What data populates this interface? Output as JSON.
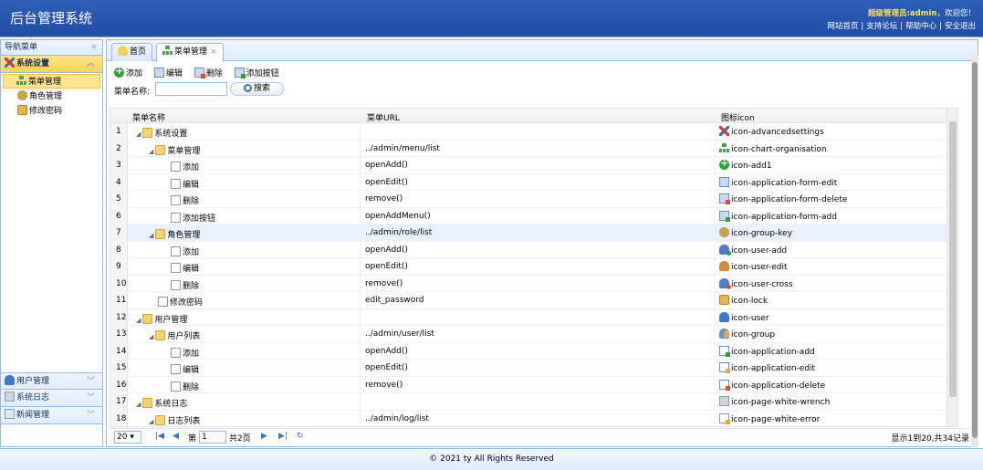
{
  "header": {
    "title": "后台管理系统",
    "welcome_user": "超级管理员:admin",
    "welcome_text": "，欢迎您！",
    "links": [
      "网站首页",
      "支持论坛",
      "帮助中心",
      "安全退出"
    ]
  },
  "sidebar": {
    "title": "导航菜单",
    "groups": [
      {
        "label": "系统设置",
        "icon": "advanced-settings-icon",
        "selected": true,
        "items": [
          {
            "label": "菜单管理",
            "icon": "org-chart-icon",
            "selected": true
          },
          {
            "label": "角色管理",
            "icon": "group-key-icon"
          },
          {
            "label": "修改密码",
            "icon": "lock-icon"
          }
        ]
      },
      {
        "label": "用户管理",
        "icon": "user-icon"
      },
      {
        "label": "系统日志",
        "icon": "wrench-icon"
      },
      {
        "label": "新闻管理",
        "icon": "news-icon"
      }
    ]
  },
  "tabs": [
    {
      "label": "首页",
      "icon": "home-icon"
    },
    {
      "label": "菜单管理",
      "icon": "org-chart-icon",
      "closable": true,
      "selected": true
    }
  ],
  "toolbar": {
    "add": "添加",
    "edit": "编辑",
    "del": "删除",
    "add_button": "添加按钮"
  },
  "search": {
    "label": "菜单名称:",
    "value": "",
    "button": "搜索"
  },
  "grid": {
    "columns": [
      "菜单名称",
      "菜单URL",
      "图标icon"
    ],
    "rows": [
      {
        "n": "1",
        "name": "系统设置",
        "level": 0,
        "type": "folder",
        "expand": true,
        "url": "",
        "icon": "icon-advancedsettings",
        "ic": "adv"
      },
      {
        "n": "2",
        "name": "菜单管理",
        "level": 1,
        "type": "folder",
        "expand": true,
        "url": "../admin/menu/list",
        "icon": "icon-chart-organisation",
        "ic": "org"
      },
      {
        "n": "3",
        "name": "添加",
        "level": 2,
        "type": "doc",
        "url": "openAdd()",
        "icon": "icon-add1",
        "ic": "add"
      },
      {
        "n": "4",
        "name": "编辑",
        "level": 2,
        "type": "doc",
        "url": "openEdit()",
        "icon": "icon-application-form-edit",
        "ic": "edit"
      },
      {
        "n": "5",
        "name": "删除",
        "level": 2,
        "type": "doc",
        "url": "remove()",
        "icon": "icon-application-form-delete",
        "ic": "del"
      },
      {
        "n": "6",
        "name": "添加按钮",
        "level": 2,
        "type": "doc",
        "url": "openAddMenu()",
        "icon": "icon-application-form-add",
        "ic": "formadd"
      },
      {
        "n": "7",
        "name": "角色管理",
        "level": 1,
        "type": "folder",
        "expand": true,
        "url": "../admin/role/list",
        "icon": "icon-group-key",
        "ic": "groupkey",
        "hl": true
      },
      {
        "n": "8",
        "name": "添加",
        "level": 2,
        "type": "doc",
        "url": "openAdd()",
        "icon": "icon-user-add",
        "ic": "useradd"
      },
      {
        "n": "9",
        "name": "编辑",
        "level": 2,
        "type": "doc",
        "url": "openEdit()",
        "icon": "icon-user-edit",
        "ic": "useredit"
      },
      {
        "n": "10",
        "name": "删除",
        "level": 2,
        "type": "doc",
        "url": "remove()",
        "icon": "icon-user-cross",
        "ic": "usercross"
      },
      {
        "n": "11",
        "name": "修改密码",
        "level": 1,
        "type": "doc",
        "url": "edit_password",
        "icon": "icon-lock",
        "ic": "lock"
      },
      {
        "n": "12",
        "name": "用户管理",
        "level": 0,
        "type": "folder",
        "expand": true,
        "url": "",
        "icon": "icon-user",
        "ic": "user"
      },
      {
        "n": "13",
        "name": "用户列表",
        "level": 1,
        "type": "folder",
        "expand": true,
        "url": "../admin/user/list",
        "icon": "icon-group",
        "ic": "group"
      },
      {
        "n": "14",
        "name": "添加",
        "level": 2,
        "type": "doc",
        "url": "openAdd()",
        "icon": "icon-application-add",
        "ic": "appadd"
      },
      {
        "n": "15",
        "name": "编辑",
        "level": 2,
        "type": "doc",
        "url": "openEdit()",
        "icon": "icon-application-edit",
        "ic": "appedit"
      },
      {
        "n": "16",
        "name": "删除",
        "level": 2,
        "type": "doc",
        "url": "remove()",
        "icon": "icon-application-delete",
        "ic": "appdel"
      },
      {
        "n": "17",
        "name": "系统日志",
        "level": 0,
        "type": "folder",
        "expand": true,
        "url": "",
        "icon": "icon-page-white-wrench",
        "ic": "wrench"
      },
      {
        "n": "18",
        "name": "日志列表",
        "level": 1,
        "type": "folder",
        "expand": true,
        "url": "../admin/log/list",
        "icon": "icon-page-white-error",
        "ic": "pagew"
      }
    ]
  },
  "pager": {
    "page_size": "20",
    "page_label": "第",
    "page_value": "1",
    "total_pages": "共2页",
    "info": "显示1到20,共34记录"
  },
  "footer": {
    "text": "© 2021 ty All Rights Reserved"
  }
}
